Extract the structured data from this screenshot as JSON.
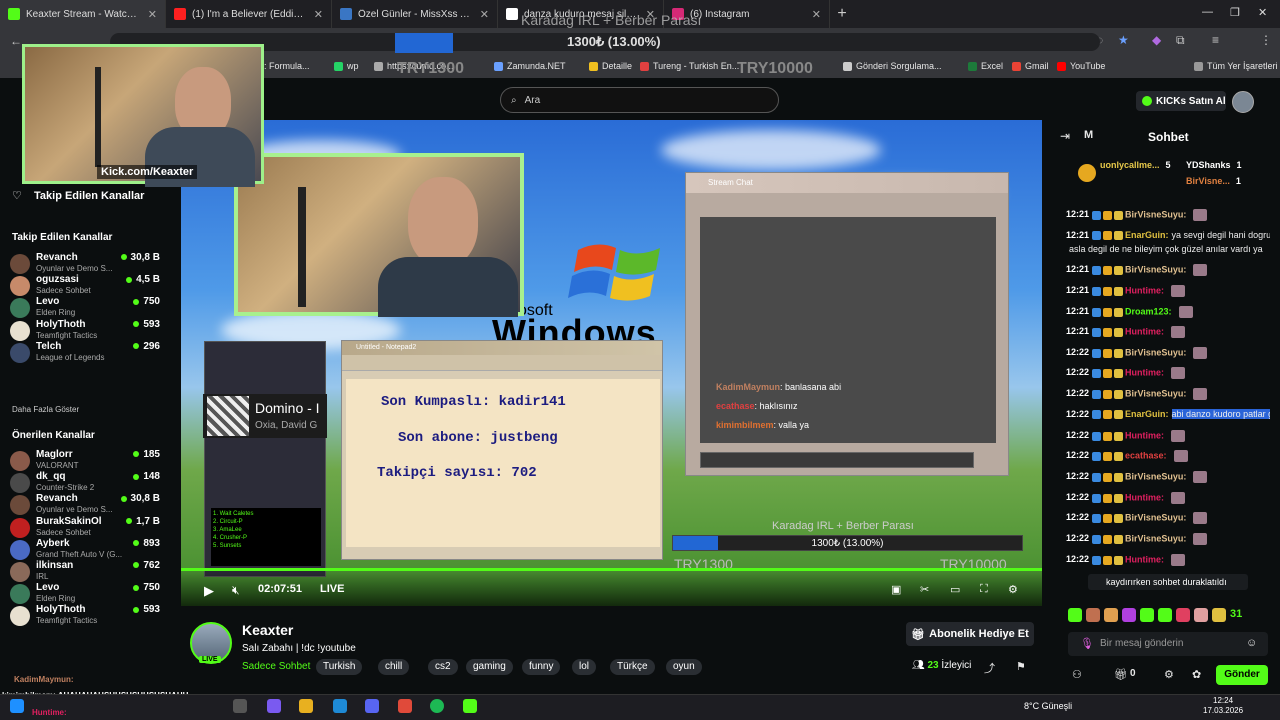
{
  "tabs": [
    {
      "title": "Keaxter Stream - Watch Live on",
      "color": "#53fc18",
      "active": true
    },
    {
      "title": "(1) I'm a Believer (Eddie Murph",
      "color": "#ff2020"
    },
    {
      "title": "Özel Günler - MissXss Al Bot Sy",
      "color": "#3a76c4"
    },
    {
      "title": "danza kuduro mesaj silme - Go",
      "color": "#ffffff"
    },
    {
      "title": "(6) Instagram",
      "color": "#d62976"
    }
  ],
  "bookmarks": [
    {
      "label": "AGE: Formula..."
    },
    {
      "label": "wp"
    },
    {
      "label": "https://turfid.co..."
    },
    {
      "label": "Zamunda.NET"
    },
    {
      "label": "Detaille"
    },
    {
      "label": "Tureng - Turkish En..."
    },
    {
      "label": "Gönderi Sorgulama..."
    },
    {
      "label": "Excel"
    },
    {
      "label": "Gmail"
    },
    {
      "label": "YouTube"
    },
    {
      "label": "Tüm Yer İşaretleri"
    }
  ],
  "overlay": {
    "bar_text": "1300₺ (13.00%)",
    "title": "Karadag IRL + Berber Parası",
    "try_left": "TRY1300",
    "try_right": "TRY10000",
    "progress": 0.13
  },
  "header": {
    "search_placeholder": "Ara",
    "kicks_label": "KICKs Satın Al"
  },
  "sidebar": {
    "following_header": "Takip Edilen Kanallar",
    "following_title": "Takip Edilen Kanallar",
    "following": [
      {
        "name": "Revanch",
        "cat": "Oyunlar ve Demo S...",
        "viewers": "30,8 B",
        "color": "#6b4a3a"
      },
      {
        "name": "oguzsasi",
        "cat": "Sadece Sohbet",
        "viewers": "4,5 B",
        "color": "#c78a6a"
      },
      {
        "name": "Levo",
        "cat": "Elden Ring",
        "viewers": "750",
        "color": "#3a7a5a"
      },
      {
        "name": "HolyThoth",
        "cat": "Teamfight Tactics",
        "viewers": "593",
        "color": "#e8e0d0"
      },
      {
        "name": "Telch",
        "cat": "League of Legends",
        "viewers": "296",
        "color": "#3a4a6a"
      }
    ],
    "show_more": "Daha Fazla Göster",
    "recommended_title": "Önerilen Kanallar",
    "recommended": [
      {
        "name": "Maglorr",
        "cat": "VALORANT",
        "viewers": "185",
        "color": "#8a5a4a"
      },
      {
        "name": "dk_qq",
        "cat": "Counter-Strike 2",
        "viewers": "148",
        "color": "#4a4a4a"
      },
      {
        "name": "Revanch",
        "cat": "Oyunlar ve Demo S...",
        "viewers": "30,8 B",
        "color": "#6b4a3a"
      },
      {
        "name": "BurakSakinOl",
        "cat": "Sadece Sohbet",
        "viewers": "1,7 B",
        "color": "#c02020"
      },
      {
        "name": "Ayberk",
        "cat": "Grand Theft Auto V (G...",
        "viewers": "893",
        "color": "#4a6ac4"
      },
      {
        "name": "ilkinsan",
        "cat": "IRL",
        "viewers": "762",
        "color": "#8a6a5a"
      },
      {
        "name": "Levo",
        "cat": "Elden Ring",
        "viewers": "750",
        "color": "#3a7a5a"
      },
      {
        "name": "HolyThoth",
        "cat": "Teamfight Tactics",
        "viewers": "593",
        "color": "#e8e0d0"
      }
    ]
  },
  "stream": {
    "cam_handle": "Kick.com/Keaxter",
    "notepad_title": "Untitled - Notepad2",
    "notepad_lines": [
      "Son Kumpaslı: kadir141",
      "Son abone: justbeng",
      "Takipçi sayısı: 702"
    ],
    "winamp_song": "Domino - I",
    "winamp_artist": "Oxia, David G",
    "chatwin_title": "Stream Chat",
    "chatwin_msgs": [
      {
        "user": "KadimMaymun",
        "msg": ": banlasana abi",
        "color": "#c08060"
      },
      {
        "user": "ecathase",
        "msg": ": haklısınız",
        "color": "#e04040"
      },
      {
        "user": "kimimbilmem",
        "msg": ": valla ya",
        "color": "#e07030"
      }
    ],
    "time": "02:07:51",
    "live": "LIVE"
  },
  "info": {
    "streamer": "Keaxter",
    "live_badge": "LIVE",
    "title": "Salı Zabahı | !dc !youtube",
    "category": "Sadece Sohbet",
    "tags": [
      "Turkish",
      "chill",
      "cs2",
      "gaming",
      "funny",
      "lol",
      "Türkçe",
      "oyun"
    ],
    "sub_button": "Abonelik Hediye Et",
    "viewers": "23",
    "viewers_label": "İzleyici"
  },
  "chat": {
    "header_left": "M",
    "header": "Sohbet",
    "top": [
      {
        "user": "uonlycallme...",
        "count": "5",
        "color": "#e6c84a"
      },
      {
        "user": "YDShanks",
        "count": "1",
        "color": "#ffffff"
      },
      {
        "user": "BirVisne...",
        "count": "1",
        "color": "#e08040"
      }
    ],
    "messages": [
      {
        "time": "12:21",
        "user": "BirVisneSuyu:",
        "msg": "",
        "color": "#e0c090"
      },
      {
        "time": "12:21",
        "user": "EnarGuin:",
        "msg": "ya sevgi degil hani dogru kişi",
        "color": "#e0c040"
      },
      {
        "time": "",
        "user": "",
        "msg": "asla degil de ne bileyim çok güzel anılar vardı ya",
        "color": "#fff"
      },
      {
        "time": "12:21",
        "user": "BirVisneSuyu:",
        "msg": "",
        "color": "#e0c090"
      },
      {
        "time": "12:21",
        "user": "Huntime:",
        "msg": "",
        "color": "#e02060"
      },
      {
        "time": "12:21",
        "user": "Droam123:",
        "msg": "",
        "color": "#53fc18"
      },
      {
        "time": "12:21",
        "user": "Huntime:",
        "msg": "",
        "color": "#e02060"
      },
      {
        "time": "12:22",
        "user": "BirVisneSuyu:",
        "msg": "",
        "color": "#e0c090"
      },
      {
        "time": "12:22",
        "user": "Huntime:",
        "msg": "",
        "color": "#e02060"
      },
      {
        "time": "12:22",
        "user": "BirVisneSuyu:",
        "msg": "",
        "color": "#e0c090"
      },
      {
        "time": "12:22",
        "user": "EnarGuin:",
        "msg": "abi danzo kudoro patlar gibi",
        "color": "#e0c040"
      },
      {
        "time": "12:22",
        "user": "Huntime:",
        "msg": "",
        "color": "#e02060"
      },
      {
        "time": "12:22",
        "user": "ecathase:",
        "msg": "",
        "color": "#e04040"
      },
      {
        "time": "12:22",
        "user": "BirVisneSuyu:",
        "msg": "",
        "color": "#e0c090"
      },
      {
        "time": "12:22",
        "user": "Huntime:",
        "msg": "",
        "color": "#e02060"
      },
      {
        "time": "12:22",
        "user": "BirVisneSuyu:",
        "msg": "",
        "color": "#e0c090"
      },
      {
        "time": "12:22",
        "user": "BirVisneSuyu:",
        "msg": "",
        "color": "#e0c090"
      },
      {
        "time": "12:22",
        "user": "Huntime:",
        "msg": "",
        "color": "#e02060"
      }
    ],
    "paused": "kaydırırken sohbet duraklatıldı",
    "input_placeholder": "Bir mesaj gönderin",
    "send": "Gönder",
    "kicks_count": "0",
    "emote_count": "31"
  },
  "overlay_chat": {
    "line1": "KadimMaymun:",
    "line2": "kimimbilmem: AHAHAHAHSHHSHSHHSHSHAHH",
    "line3": "Huntime:"
  },
  "taskbar": {
    "weather": "8°C  Güneşli",
    "time": "12:24",
    "date": "17.03.2026"
  }
}
